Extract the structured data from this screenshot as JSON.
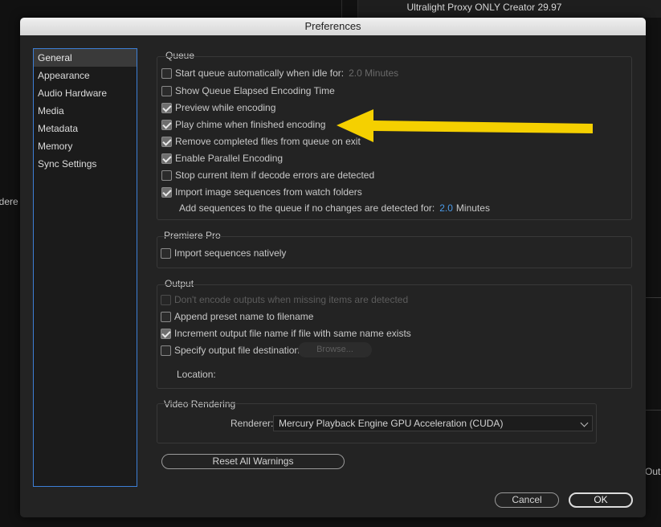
{
  "background": {
    "window_title": "Ultralight Proxy ONLY Creator 29.97",
    "left_partial_text": "adere",
    "right_partial_text": "Outp"
  },
  "dialog": {
    "title": "Preferences",
    "sidebar": {
      "items": [
        {
          "label": "General",
          "selected": true
        },
        {
          "label": "Appearance"
        },
        {
          "label": "Audio Hardware"
        },
        {
          "label": "Media"
        },
        {
          "label": "Metadata"
        },
        {
          "label": "Memory"
        },
        {
          "label": "Sync Settings"
        }
      ]
    },
    "queue": {
      "title": "Queue",
      "start_auto": {
        "label": "Start queue automatically when idle for:",
        "value": "2.0 Minutes",
        "checked": false
      },
      "show_elapsed": {
        "label": "Show Queue Elapsed Encoding Time",
        "checked": false
      },
      "preview": {
        "label": "Preview while encoding",
        "checked": true
      },
      "chime": {
        "label": "Play chime when finished encoding",
        "checked": true
      },
      "remove_completed": {
        "label": "Remove completed files from queue on exit",
        "checked": true
      },
      "parallel": {
        "label": "Enable Parallel Encoding",
        "checked": true
      },
      "stop_decode": {
        "label": "Stop current item if decode errors are detected",
        "checked": false
      },
      "import_sequences": {
        "label": "Import image sequences from watch folders",
        "checked": true
      },
      "add_sequences": {
        "label": "Add sequences to the queue if no changes are detected for:",
        "value": "2.0",
        "unit": "Minutes"
      }
    },
    "premiere": {
      "title": "Premiere Pro",
      "import_native": {
        "label": "Import sequences natively",
        "checked": false
      }
    },
    "output": {
      "title": "Output",
      "dont_encode": {
        "label": "Don't encode outputs when missing items are detected",
        "checked": false,
        "disabled": true
      },
      "append_preset": {
        "label": "Append preset name to filename",
        "checked": false
      },
      "increment": {
        "label": "Increment output file name if file with same name exists",
        "checked": true
      },
      "specify_dest": {
        "label": "Specify output file destination:",
        "checked": false
      },
      "browse_label": "Browse...",
      "location_label": "Location:"
    },
    "video_rendering": {
      "title": "Video Rendering",
      "renderer_label": "Renderer:",
      "renderer_value": "Mercury Playback Engine GPU Acceleration (CUDA)"
    },
    "reset_warnings_label": "Reset All Warnings",
    "cancel_label": "Cancel",
    "ok_label": "OK"
  },
  "annotation": {
    "type": "arrow",
    "color": "#f5d000",
    "points_to": "Play chime when finished encoding"
  }
}
